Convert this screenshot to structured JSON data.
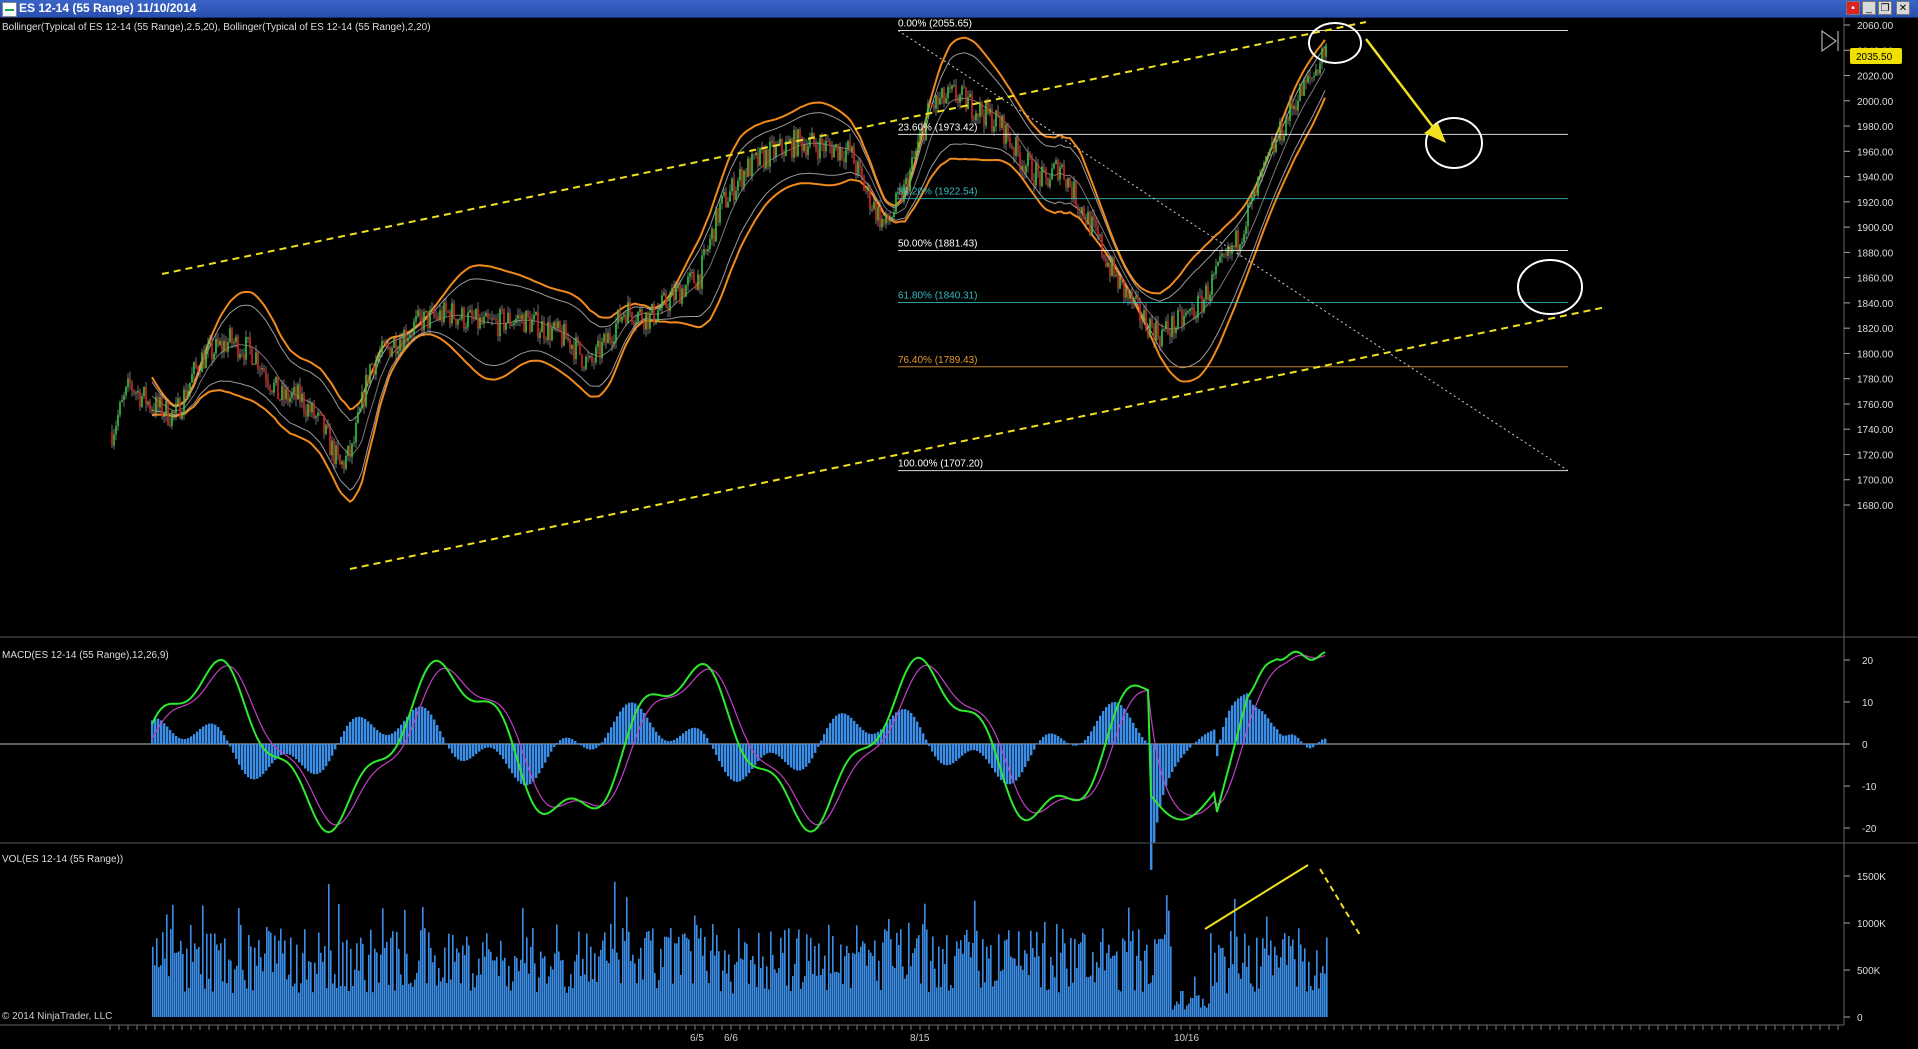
{
  "window": {
    "title": "ES 12-14 (55 Range)  11/10/2014",
    "buttons": [
      "▪",
      "_",
      "❐",
      "✕"
    ]
  },
  "price_panel": {
    "label": "Bollinger(Typical of ES 12-14 (55 Range),2.5,20), Bollinger(Typical of ES 12-14 (55 Range),2,20)",
    "current_price": "2035.50",
    "fib_levels": [
      {
        "label": "0.00% (2055.65)",
        "price": 2055.65,
        "color": "#ffffff"
      },
      {
        "label": "23.60% (1973.42)",
        "price": 1973.42,
        "color": "#ffffff"
      },
      {
        "label": "38.20% (1922.54)",
        "price": 1922.54,
        "color": "#38b8c0"
      },
      {
        "label": "50.00% (1881.43)",
        "price": 1881.43,
        "color": "#ffffff"
      },
      {
        "label": "61.80% (1840.31)",
        "price": 1840.31,
        "color": "#38b8c0"
      },
      {
        "label": "76.40% (1789.43)",
        "price": 1789.43,
        "color": "#e89530"
      },
      {
        "label": "100.00% (1707.20)",
        "price": 1707.2,
        "color": "#ffffff"
      }
    ],
    "axis_ticks": [
      "2060.00",
      "2040.00",
      "2020.00",
      "2000.00",
      "1980.00",
      "1960.00",
      "1940.00",
      "1920.00",
      "1900.00",
      "1880.00",
      "1860.00",
      "1840.00",
      "1820.00",
      "1800.00",
      "1780.00",
      "1760.00",
      "1740.00",
      "1720.00",
      "1700.00",
      "1680.00"
    ]
  },
  "macd_panel": {
    "label": "MACD(ES 12-14 (55 Range),12,26,9)",
    "axis_ticks": [
      "20",
      "10",
      "0",
      "-10",
      "-20"
    ]
  },
  "vol_panel": {
    "label": "VOL(ES 12-14 (55 Range))",
    "axis_ticks": [
      "1500K",
      "1000K",
      "500K",
      "0"
    ]
  },
  "x_axis": {
    "visible_labels": [
      "6/5",
      "6/6",
      "8/15",
      "10/16"
    ]
  },
  "copyright": "© 2014 NinjaTrader, LLC",
  "colors": {
    "background": "#000000",
    "bollinger_outer": "#f08a1c",
    "bollinger_inner": "#9a9a9a",
    "channel": "#f0e020",
    "macd": "#2ee82e",
    "signal": "#c040c0",
    "histogram": "#3a8ee8",
    "volume": "#3a8ee8",
    "up_candle": "#2ecc40",
    "down_candle": "#e02020",
    "price_badge": "#f0e000"
  }
}
